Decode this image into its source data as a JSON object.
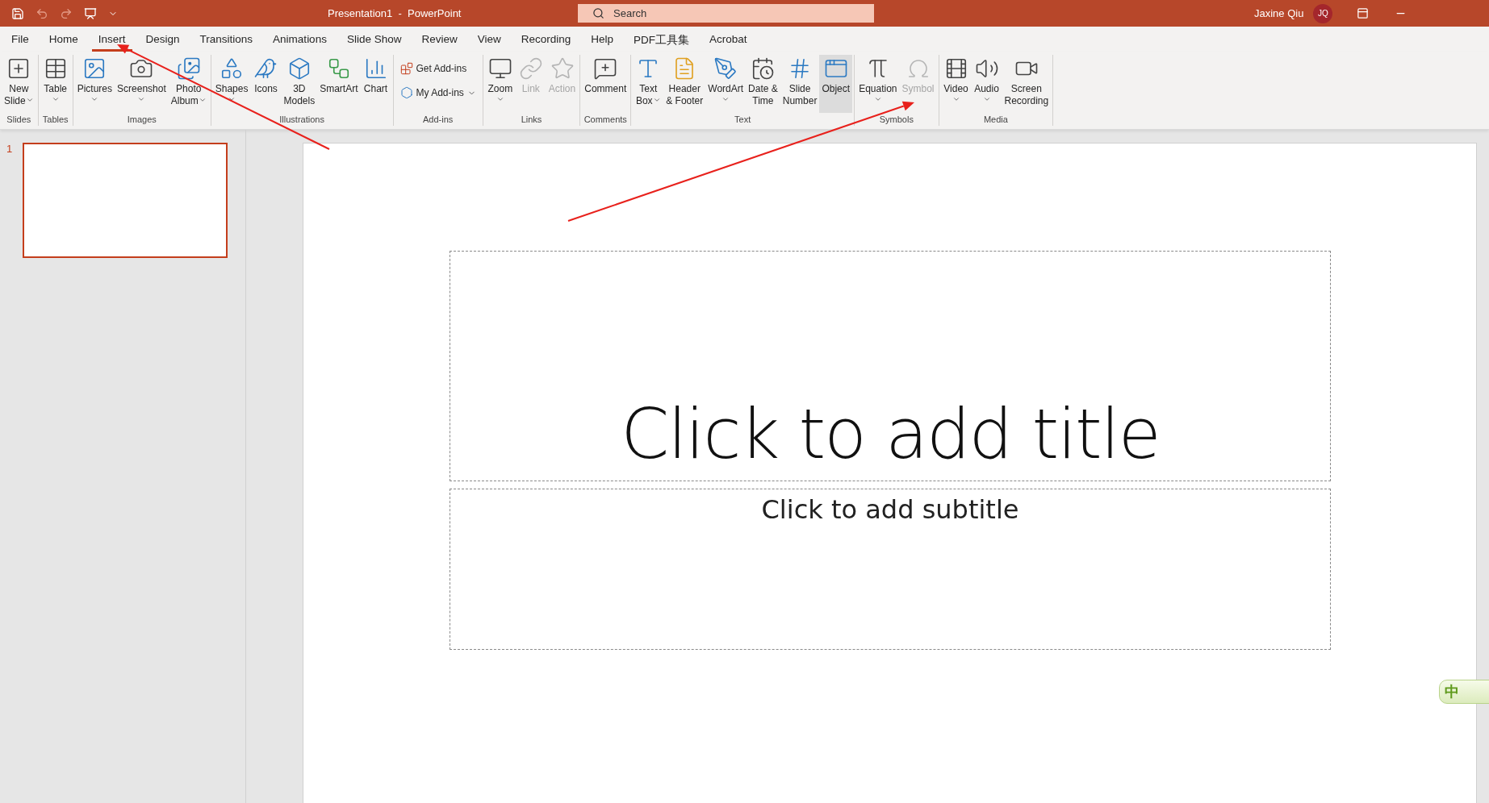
{
  "title_bar": {
    "document_title": "Presentation1  -  PowerPoint",
    "search_placeholder": "Search",
    "user_name": "Jaxine Qiu",
    "avatar_initials": "JQ"
  },
  "tabs": [
    {
      "label": "File",
      "selected": false
    },
    {
      "label": "Home",
      "selected": false
    },
    {
      "label": "Insert",
      "selected": true
    },
    {
      "label": "Design",
      "selected": false
    },
    {
      "label": "Transitions",
      "selected": false
    },
    {
      "label": "Animations",
      "selected": false
    },
    {
      "label": "Slide Show",
      "selected": false
    },
    {
      "label": "Review",
      "selected": false
    },
    {
      "label": "View",
      "selected": false
    },
    {
      "label": "Recording",
      "selected": false
    },
    {
      "label": "Help",
      "selected": false
    },
    {
      "label": "PDF工具集",
      "selected": false
    },
    {
      "label": "Acrobat",
      "selected": false
    }
  ],
  "ribbon": {
    "groups": [
      {
        "label": "Slides",
        "items": [
          {
            "label": "New\nSlide",
            "kind": "large",
            "dropdown": true,
            "disabled": false,
            "highlighted": false
          }
        ]
      },
      {
        "label": "Tables",
        "items": [
          {
            "label": "Table",
            "kind": "large",
            "dropdown": true,
            "disabled": false,
            "highlighted": false
          }
        ]
      },
      {
        "label": "Images",
        "items": [
          {
            "label": "Pictures",
            "kind": "large",
            "dropdown": true,
            "disabled": false,
            "highlighted": false
          },
          {
            "label": "Screenshot",
            "kind": "large",
            "dropdown": true,
            "disabled": false,
            "highlighted": false
          },
          {
            "label": "Photo\nAlbum",
            "kind": "large",
            "dropdown": true,
            "disabled": false,
            "highlighted": false
          }
        ]
      },
      {
        "label": "Illustrations",
        "items": [
          {
            "label": "Shapes",
            "kind": "large",
            "dropdown": true,
            "disabled": false,
            "highlighted": false
          },
          {
            "label": "Icons",
            "kind": "large",
            "dropdown": false,
            "disabled": false,
            "highlighted": false
          },
          {
            "label": "3D\nModels",
            "kind": "large",
            "dropdown": false,
            "disabled": false,
            "highlighted": false
          },
          {
            "label": "SmartArt",
            "kind": "large",
            "dropdown": false,
            "disabled": false,
            "highlighted": false
          },
          {
            "label": "Chart",
            "kind": "large",
            "dropdown": false,
            "disabled": false,
            "highlighted": false
          }
        ]
      },
      {
        "label": "Add-ins",
        "items": [
          {
            "label": "Get Add-ins",
            "kind": "small",
            "dropdown": false,
            "disabled": false,
            "highlighted": false
          },
          {
            "label": "My Add-ins",
            "kind": "small",
            "dropdown": true,
            "disabled": false,
            "highlighted": false
          }
        ]
      },
      {
        "label": "Links",
        "items": [
          {
            "label": "Zoom",
            "kind": "large",
            "dropdown": true,
            "disabled": false,
            "highlighted": false
          },
          {
            "label": "Link",
            "kind": "large",
            "dropdown": false,
            "disabled": true,
            "highlighted": false
          },
          {
            "label": "Action",
            "kind": "large",
            "dropdown": false,
            "disabled": true,
            "highlighted": false
          }
        ]
      },
      {
        "label": "Comments",
        "items": [
          {
            "label": "Comment",
            "kind": "large",
            "dropdown": false,
            "disabled": false,
            "highlighted": false
          }
        ]
      },
      {
        "label": "Text",
        "items": [
          {
            "label": "Text\nBox",
            "kind": "large",
            "dropdown": true,
            "disabled": false,
            "highlighted": false
          },
          {
            "label": "Header\n& Footer",
            "kind": "large",
            "dropdown": false,
            "disabled": false,
            "highlighted": false
          },
          {
            "label": "WordArt",
            "kind": "large",
            "dropdown": true,
            "disabled": false,
            "highlighted": false
          },
          {
            "label": "Date &\nTime",
            "kind": "large",
            "dropdown": false,
            "disabled": false,
            "highlighted": false
          },
          {
            "label": "Slide\nNumber",
            "kind": "large",
            "dropdown": false,
            "disabled": false,
            "highlighted": false
          },
          {
            "label": "Object",
            "kind": "large",
            "dropdown": false,
            "disabled": false,
            "highlighted": true
          }
        ]
      },
      {
        "label": "Symbols",
        "items": [
          {
            "label": "Equation",
            "kind": "large",
            "dropdown": true,
            "disabled": false,
            "highlighted": false
          },
          {
            "label": "Symbol",
            "kind": "large",
            "dropdown": false,
            "disabled": true,
            "highlighted": false
          }
        ]
      },
      {
        "label": "Media",
        "items": [
          {
            "label": "Video",
            "kind": "large",
            "dropdown": true,
            "disabled": false,
            "highlighted": false
          },
          {
            "label": "Audio",
            "kind": "large",
            "dropdown": true,
            "disabled": false,
            "highlighted": false
          },
          {
            "label": "Screen\nRecording",
            "kind": "large",
            "dropdown": false,
            "disabled": false,
            "highlighted": false
          }
        ]
      }
    ]
  },
  "thumbnails": [
    {
      "number": "1",
      "selected": true
    }
  ],
  "slide": {
    "title_placeholder": "Click to add title",
    "subtitle_placeholder": "Click to add subtitle"
  },
  "ime_indicator": {
    "label": "中"
  }
}
